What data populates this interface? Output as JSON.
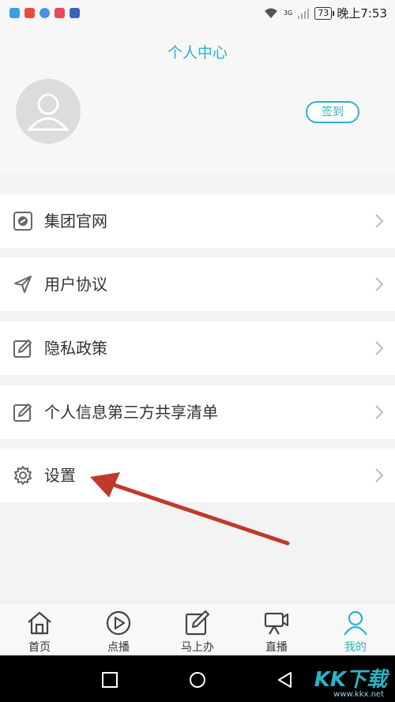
{
  "status_bar": {
    "time": "晚上7:53",
    "battery": "73",
    "network": "3G",
    "app_notification_colors": [
      "#3aa0e6",
      "#e74c3c",
      "#4d8fe0",
      "#e84a5f",
      "#3a64b8"
    ]
  },
  "header": {
    "title": "个人中心",
    "signin_label": "签到"
  },
  "menu": [
    {
      "label": "集团官网",
      "icon": "website-icon"
    },
    {
      "label": "用户协议",
      "icon": "send-icon"
    },
    {
      "label": "隐私政策",
      "icon": "edit-icon"
    },
    {
      "label": "个人信息第三方共享清单",
      "icon": "edit-icon"
    },
    {
      "label": "设置",
      "icon": "gear-icon"
    }
  ],
  "bottom_nav": [
    {
      "label": "首页",
      "icon": "home-icon",
      "active": false
    },
    {
      "label": "点播",
      "icon": "play-icon",
      "active": false
    },
    {
      "label": "马上办",
      "icon": "pen-icon",
      "active": false
    },
    {
      "label": "直播",
      "icon": "camera-icon",
      "active": false
    },
    {
      "label": "我的",
      "icon": "user-icon",
      "active": true
    }
  ],
  "watermark": {
    "logo": "KK下载",
    "url": "www.kkx.net"
  },
  "colors": {
    "accent": "#2bb3c9",
    "annotation_arrow": "#c0392b"
  }
}
